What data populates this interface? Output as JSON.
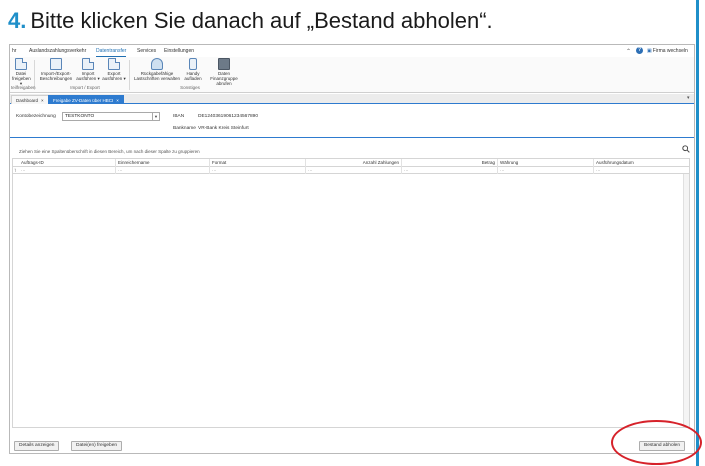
{
  "instruction": {
    "number": "4.",
    "text": "Bitte klicken Sie danach auf „Bestand abholen“."
  },
  "menubar": {
    "items": [
      {
        "label": "hr",
        "active": false
      },
      {
        "label": "Auslandszahlungsverkehr",
        "active": false
      },
      {
        "label": "Datentransfer",
        "active": true
      },
      {
        "label": "Services",
        "active": false
      },
      {
        "label": "Einstellungen",
        "active": false
      }
    ],
    "help_glyph": "?",
    "firm_link": "Firma wechseln"
  },
  "ribbon": {
    "buttons": [
      {
        "line1": "Datei",
        "line2": "freigeben ▾",
        "icon": "file-release-icon"
      },
      {
        "line1": "Import-/Export-",
        "line2": "Beschreibungen",
        "icon": "import-export-desc-icon"
      },
      {
        "line1": "Import",
        "line2": "ausführen ▾",
        "icon": "import-icon"
      },
      {
        "line1": "Export",
        "line2": "ausführen ▾",
        "icon": "export-icon"
      },
      {
        "line1": "Rückgabefähige",
        "line2": "Lastschriften verwalten",
        "icon": "returnable-debits-icon"
      },
      {
        "line1": "Handy",
        "line2": "aufladen",
        "icon": "phone-topup-icon"
      },
      {
        "line1": "Daten Finanzgruppe",
        "line2": "abrufen",
        "icon": "finance-group-icon"
      }
    ],
    "groups": [
      "teilfreigaben",
      "Import / Export",
      "Sonstiges"
    ]
  },
  "tabs": [
    {
      "label": "Dashboard",
      "active": false
    },
    {
      "label": "Freigabe ZV-Daten über HBCI",
      "active": true
    }
  ],
  "form": {
    "konto_label": "Kontobezeichnung",
    "konto_value": "TESTKONTO",
    "iban_label": "IBAN",
    "iban_value": "DE12403619061234567890",
    "bank_label": "Bankname",
    "bank_value": "VR-Bank Kreis Steinfurt"
  },
  "grid": {
    "group_hint": "Ziehen Sie eine Spaltenüberschrift in diesen Bereich, um nach dieser Spalte zu gruppieren",
    "columns": [
      "Auftrags-ID",
      "Einreichername",
      "Format",
      "Anzahl Zahlungen",
      "Betrag",
      "Währung",
      "Ausführungsdatum"
    ],
    "filter_glyph": "⊺",
    "filter_placeholder": "···"
  },
  "footer": {
    "details_button": "Details anzeigen",
    "release_button": "Datei(en) freigeben",
    "fetch_button": "Bestand abholen"
  },
  "colors": {
    "accent": "#1f8fc9",
    "tab_active": "#2e7bcf",
    "highlight": "#d6222a"
  }
}
